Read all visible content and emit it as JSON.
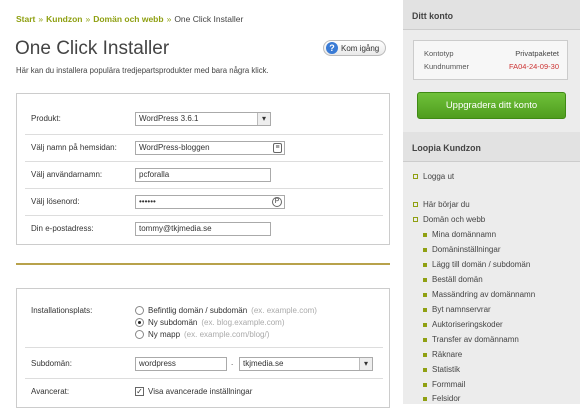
{
  "breadcrumb": {
    "items": [
      "Start",
      "Kundzon",
      "Domän och webb"
    ],
    "separator": "»",
    "current": "One Click Installer"
  },
  "page": {
    "title": "One Click Installer",
    "subtitle": "Här kan du installera populära tredjepartsprodukter med bara några klick.",
    "help_label": "Kom igång"
  },
  "form": {
    "product_label": "Produkt:",
    "product_value": "WordPress 3.6.1",
    "site_name_label": "Välj namn på hemsidan:",
    "site_name_value": "WordPress-bloggen",
    "username_label": "Välj användarnamn:",
    "username_value": "pcforalla",
    "password_label": "Välj lösenord:",
    "password_value": "••••••",
    "email_label": "Din e-postadress:",
    "email_value": "tommy@tkjmedia.se"
  },
  "install": {
    "location_label": "Installationsplats:",
    "options": [
      {
        "label": "Befintlig domän / subdomän",
        "hint": "(ex. example.com)",
        "selected": false
      },
      {
        "label": "Ny subdomän",
        "hint": "(ex. blog.example.com)",
        "selected": true
      },
      {
        "label": "Ny mapp",
        "hint": "(ex. example.com/blog/)",
        "selected": false
      }
    ],
    "subdomain_label": "Subdomän:",
    "subdomain_value": "wordpress",
    "subdomain_dot": ".",
    "domain_value": "tkjmedia.se",
    "advanced_label": "Avancerat:",
    "advanced_check_label": "Visa avancerade inställningar",
    "advanced_checked": true
  },
  "sidebar": {
    "account_title": "Ditt konto",
    "account_type_label": "Kontotyp",
    "account_type_value": "Privatpaketet",
    "customer_number_label": "Kundnummer",
    "customer_number_value": "FA04-24-09-30",
    "upgrade_label": "Uppgradera ditt konto",
    "kundzon_title": "Loopia Kundzon",
    "top_items": [
      "Logga ut",
      "Här börjar du",
      "Domän och webb"
    ],
    "sub_items": [
      "Mina domännamn",
      "Domäninställningar",
      "Lägg till domän / subdomän",
      "Beställ domän",
      "Massändring av domännamn",
      "Byt namnservrar",
      "Auktoriseringskoder",
      "Transfer av domännamn",
      "Räknare",
      "Statistik",
      "Formmail",
      "Felsidor"
    ]
  },
  "colors": {
    "accent": "#8fa012",
    "upgrade": "#5aac28",
    "customer_number": "#cc3333",
    "divider": "#b8a24b"
  }
}
